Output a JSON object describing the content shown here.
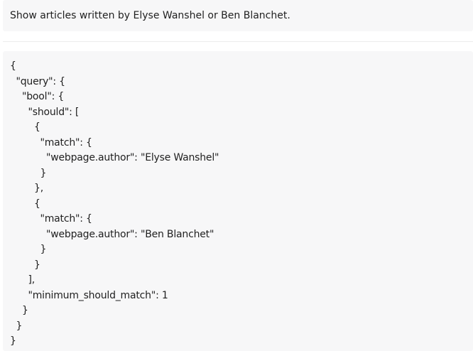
{
  "prompt": {
    "text": "Show articles written by Elyse Wanshel or Ben Blanchet."
  },
  "code": {
    "lines": [
      "{",
      "  \"query\": {",
      "    \"bool\": {",
      "      \"should\": [",
      "        {",
      "          \"match\": {",
      "            \"webpage.author\": \"Elyse Wanshel\"",
      "          }",
      "        },",
      "        {",
      "          \"match\": {",
      "            \"webpage.author\": \"Ben Blanchet\"",
      "          }",
      "        }",
      "      ],",
      "      \"minimum_should_match\": 1",
      "    }",
      "  }",
      "}"
    ]
  }
}
